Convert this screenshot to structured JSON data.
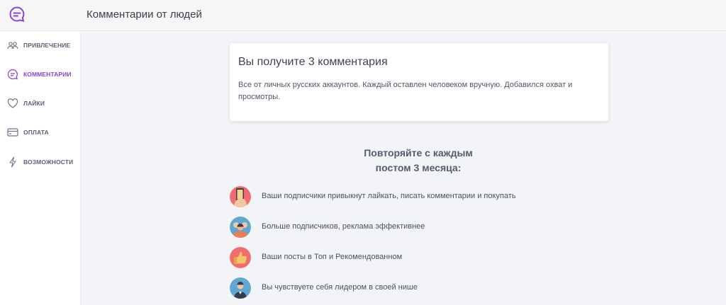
{
  "header": {
    "title": "Комментарии от людей",
    "logo_icon": "chat-bubble-icon",
    "accent": "#8b43d6"
  },
  "sidebar": {
    "items": [
      {
        "label": "ПРИВЛЕЧЕНИЕ",
        "icon": "people-icon",
        "active": false
      },
      {
        "label": "КОММЕНТАРИИ",
        "icon": "comment-icon",
        "active": true
      },
      {
        "label": "ЛАЙКИ",
        "icon": "heart-icon",
        "active": false
      },
      {
        "label": "ОПЛАТА",
        "icon": "card-icon",
        "active": false
      },
      {
        "label": "ВОЗМОЖНОСТИ",
        "icon": "lightning-icon",
        "active": false
      }
    ]
  },
  "card": {
    "title": "Вы получите 3 комментария",
    "text": "Все от личных русских аккаунтов. Каждый оставлен человеком вручную. Добавился охват и просмотры."
  },
  "benefits": {
    "heading_line1": "Повторяйте с каждым",
    "heading_line2": "постом 3 месяца:",
    "items": [
      {
        "text": "Ваши подписчики привыкнут лайкать, писать комментарии и покупать",
        "icon": "phone-hand-icon"
      },
      {
        "text": "Больше подписчиков, реклама эффективнее",
        "icon": "people-group-icon"
      },
      {
        "text": "Ваши посты в Топ и Рекомендованном",
        "icon": "thumbs-up-icon"
      },
      {
        "text": "Вы чувствуете себя лидером в своей нише",
        "icon": "leader-icon"
      }
    ]
  }
}
